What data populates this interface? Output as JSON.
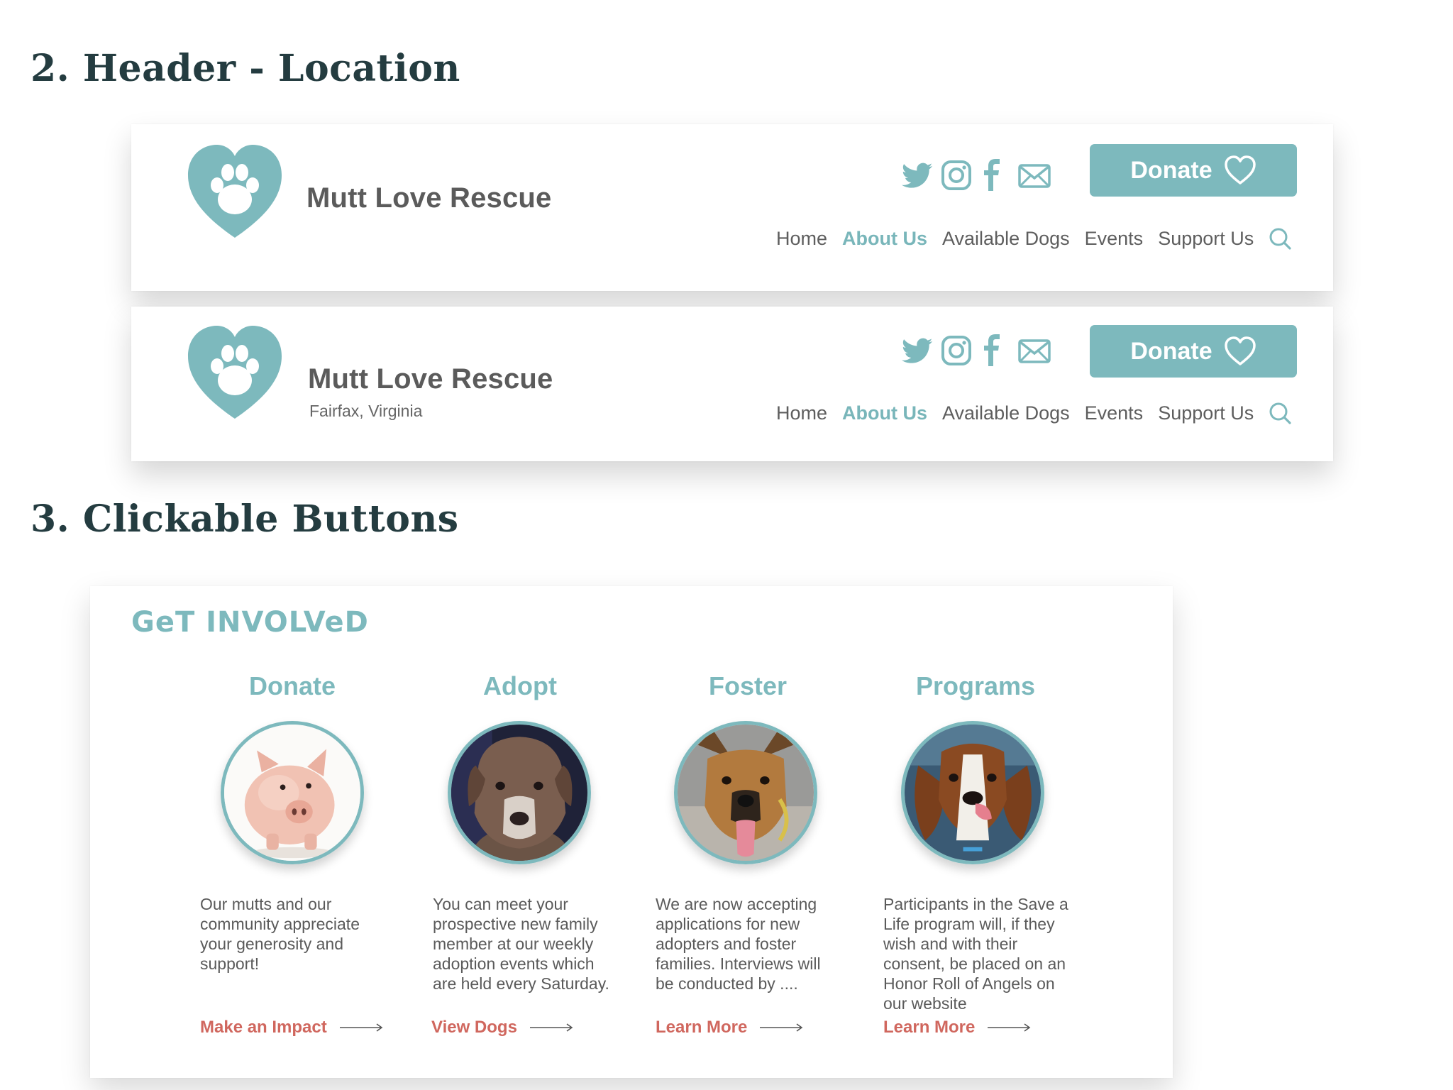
{
  "sections": {
    "header_location": "2. Header - Location",
    "clickable_buttons": "3. Clickable Buttons"
  },
  "header": {
    "site_name": "Mutt Love Rescue",
    "location": "Fairfax, Virginia",
    "donate_label": "Donate",
    "nav": [
      "Home",
      "About Us",
      "Available Dogs",
      "Events",
      "Support Us"
    ],
    "active_nav": "About Us",
    "social_icons": [
      "twitter-icon",
      "instagram-icon",
      "facebook-icon",
      "mail-icon"
    ]
  },
  "get_involved": {
    "title": "GeT INVOLVeD",
    "cards": [
      {
        "title": "Donate",
        "image": "piggy-bank",
        "text": "Our mutts and our community appreciate your generosity and support!",
        "link": "Make an Impact"
      },
      {
        "title": "Adopt",
        "image": "brown-dog",
        "text": "You can meet your prospective new family member at our weekly adoption events which are held every Saturday.",
        "link": "View Dogs"
      },
      {
        "title": "Foster",
        "image": "tan-shepherd-dog",
        "text": "We are now accepting applications for new adopters and foster families. Interviews will be conducted by ....",
        "link": "Learn More"
      },
      {
        "title": "Programs",
        "image": "beagle-dog",
        "text": "Participants in the Save a Life program will, if they wish and with their consent, be placed on an Honor Roll of Angels on our website",
        "link": "Learn More"
      }
    ]
  },
  "colors": {
    "accent": "#7db9bd",
    "heading": "#243c40",
    "link": "#d0675e",
    "text": "#5a5a5a"
  }
}
